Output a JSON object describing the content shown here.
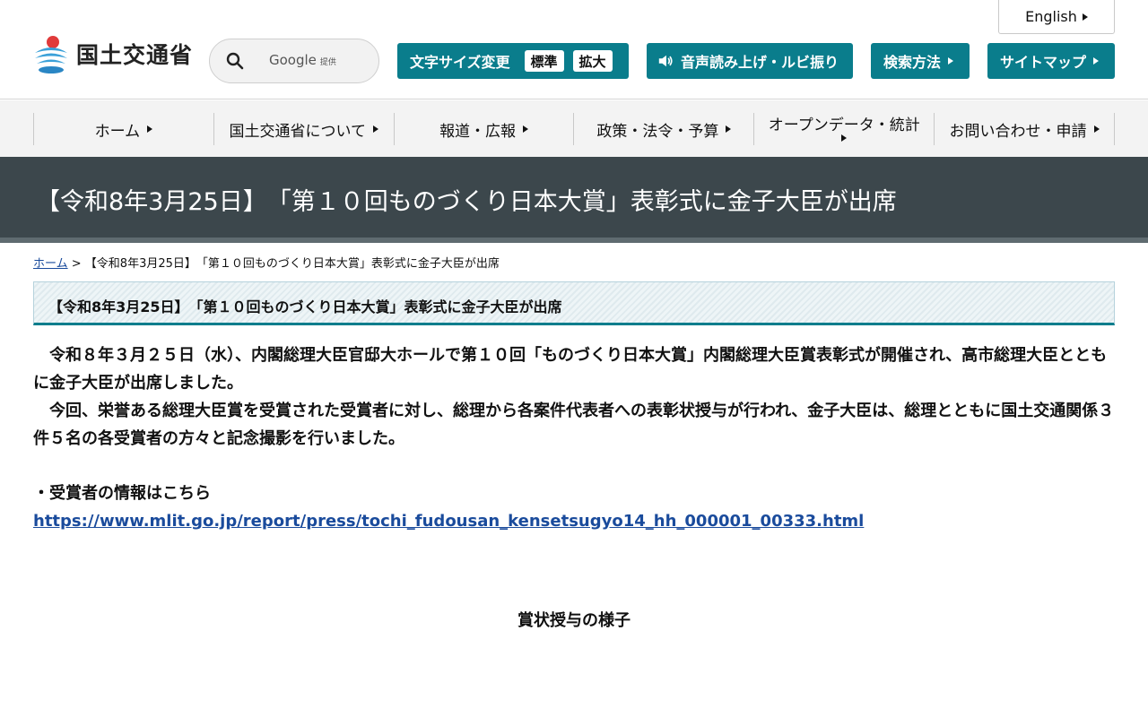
{
  "header": {
    "english_label": "English",
    "logo_text": "国土交通省",
    "search": {
      "google_label": "Google",
      "google_sub": "提供"
    },
    "font_size": {
      "label": "文字サイズ変更",
      "standard": "標準",
      "large": "拡大"
    },
    "voice_label": "音声読み上げ・ルビ振り",
    "search_method_label": "検索方法",
    "sitemap_label": "サイトマップ"
  },
  "nav": {
    "items": [
      {
        "label": "ホーム"
      },
      {
        "label": "国土交通省について"
      },
      {
        "label": "報道・広報"
      },
      {
        "label": "政策・法令・予算"
      },
      {
        "label": "オープンデータ・統計"
      },
      {
        "label": "お問い合わせ・申請"
      }
    ]
  },
  "page": {
    "title": "【令和8年3月25日】　「第１０回ものづくり日本大賞」表彰式に金子大臣が出席",
    "breadcrumb": {
      "home": "ホーム",
      "separator": " > ",
      "current": "【令和8年3月25日】　「第１０回ものづくり日本大賞」表彰式に金子大臣が出席"
    },
    "subheading": "【令和8年3月25日】　「第１０回ものづくり日本大賞」表彰式に金子大臣が出席",
    "paragraph1": "　令和８年３月２５日（水）、内閣総理大臣官邸大ホールで第１０回「ものづくり日本大賞」内閣総理大臣賞表彰式が開催され、高市総理大臣とともに金子大臣が出席しました。",
    "paragraph2": "　今回、栄誉ある総理大臣賞を受賞された受賞者に対し、総理から各案件代表者への表彰状授与が行われ、金子大臣は、総理とともに国土交通関係３件５名の各受賞者の方々と記念撮影を行いました。",
    "awardee_label": "・受賞者の情報はこちら",
    "awardee_link": "https://www.mlit.go.jp/report/press/tochi_fudousan_kensetsugyo14_hh_000001_00333.html",
    "caption": "賞状授与の様子"
  },
  "colors": {
    "accent": "#0a7d8c",
    "title_band": "#3c474c",
    "link": "#1a4b9c"
  }
}
